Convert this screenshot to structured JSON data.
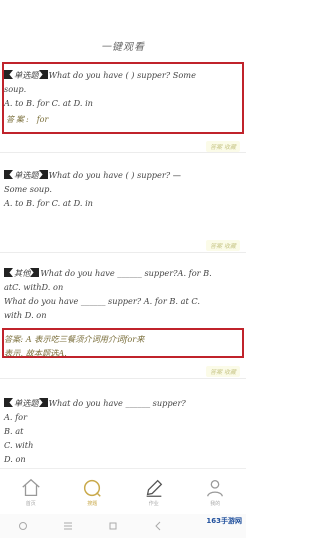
{
  "header": {
    "title": "一键观看"
  },
  "questions": [
    {
      "tag": "单选题",
      "line1": "What do you have (    ) supper? Some",
      "line2": "soup.",
      "options": "A. to B. for C. at D. in",
      "answer_label": "答案:",
      "answer": "for",
      "meta": "答案 收藏"
    },
    {
      "tag": "单选题",
      "line1": "What do you have  (    )  supper? —",
      "line2": "Some soup.",
      "options": "A. to B. for C. at D. in",
      "meta": "答案 收藏"
    },
    {
      "tag": "其他",
      "line1": "What do you have ______ supper?A.  for B.",
      "line2": "atC. withD.  on",
      "line3": "What do you have ______ supper? A.  for B.  at C.",
      "line4": "with D.  on",
      "explain": "答案: A 表示吃三餐须介词用介词for来",
      "explain2": "表示, 故本题选A.",
      "meta": "答案 收藏"
    },
    {
      "tag": "单选题",
      "line1": "What do you have ______ supper?",
      "opts": [
        "A. for",
        "B. at",
        "C. with",
        "D. on"
      ]
    }
  ],
  "tabbar": [
    {
      "label": "首页",
      "icon": "home-icon"
    },
    {
      "label": "搜题",
      "icon": "search-icon"
    },
    {
      "label": "作业",
      "icon": "pen-icon"
    },
    {
      "label": "我的",
      "icon": "user-icon"
    }
  ],
  "watermark": "163手游网"
}
